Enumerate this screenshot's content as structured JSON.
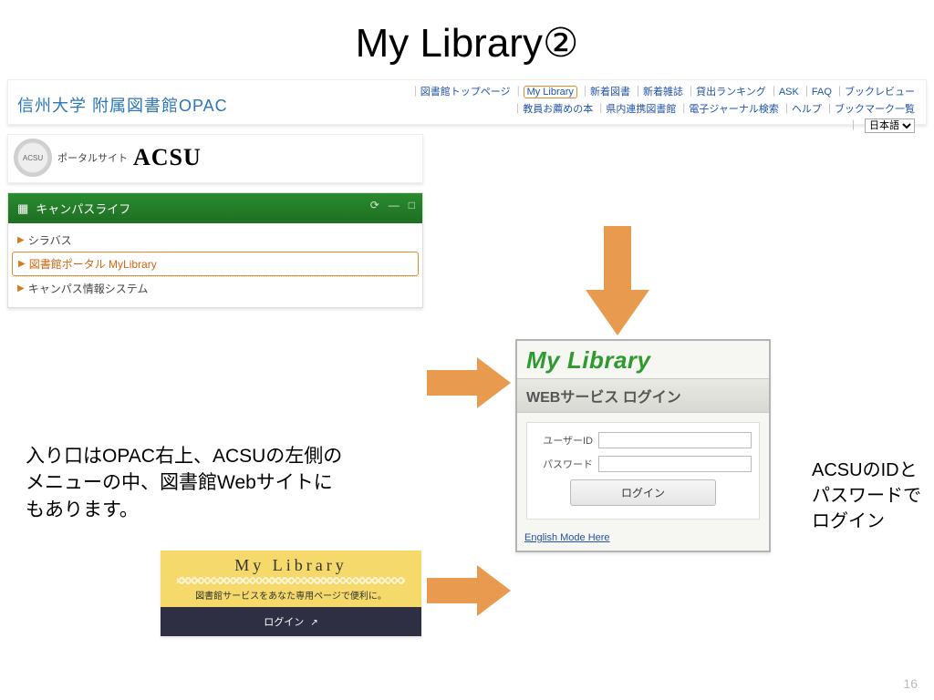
{
  "slide": {
    "title": "My Library②",
    "page_number": "16"
  },
  "opac": {
    "site_title": "信州大学 附属図書館OPAC",
    "row1": {
      "top": "図書館トップページ",
      "mylib": "My Library",
      "new_books": "新着図書",
      "new_mag": "新着雑誌",
      "ranking": "貸出ランキング",
      "ask": "ASK",
      "faq": "FAQ",
      "bookreview": "ブックレビュー"
    },
    "row2": {
      "rec": "教員お薦めの本",
      "pref": "県内連携図書館",
      "ejournal": "電子ジャーナル検索",
      "help": "ヘルプ",
      "bookmark": "ブックマーク一覧"
    },
    "lang": "日本語"
  },
  "acsu": {
    "logo_label": "ACSU",
    "label": "ポータルサイト",
    "brand": "ACSU"
  },
  "campus": {
    "head": "キャンパスライフ",
    "items": [
      "シラバス",
      "図書館ポータル MyLibrary",
      "キャンパス情報システム"
    ]
  },
  "login": {
    "title": "My Library",
    "subtitle": "WEBサービス ログイン",
    "user_label": "ユーザーID",
    "pass_label": "パスワード",
    "button": "ログイン",
    "english": "English Mode Here"
  },
  "mlcard": {
    "title": "My Library",
    "sub": "図書館サービスをあなた専用ページで便利に。",
    "button": "ログイン",
    "ext_icon": "↗"
  },
  "annot": {
    "left": "入り口はOPAC右上、ACSUの左側のメニューの中、図書館Webサイトにもあります。",
    "right": "ACSUのIDとパスワードでログイン"
  }
}
